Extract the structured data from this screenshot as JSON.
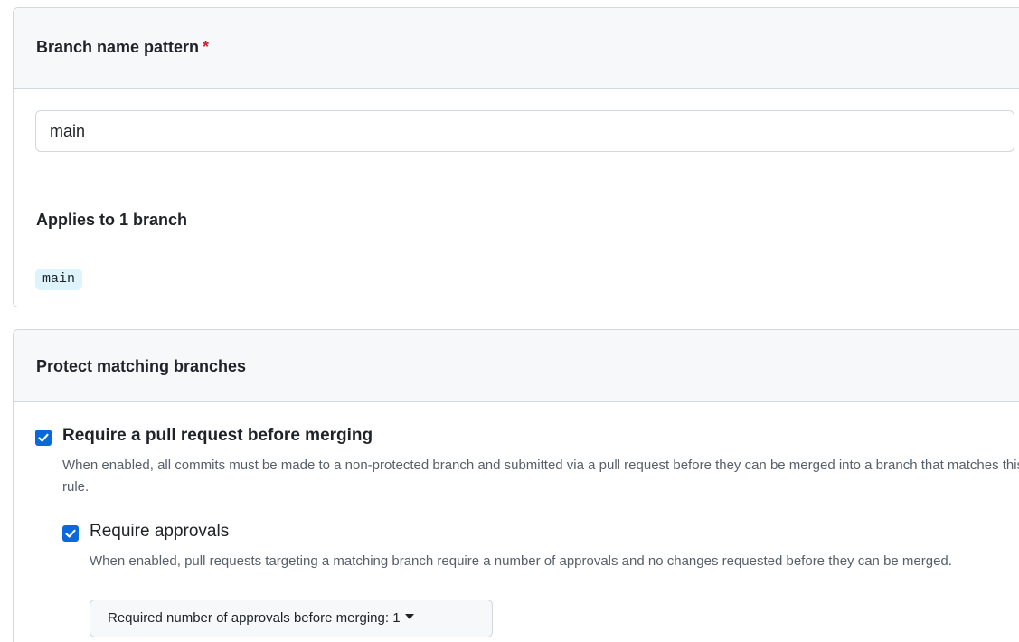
{
  "branch_pattern": {
    "label": "Branch name pattern",
    "required_marker": "*",
    "value": "main"
  },
  "applies": {
    "title": "Applies to 1 branch",
    "branches": [
      "main"
    ]
  },
  "protect": {
    "title": "Protect matching branches",
    "options": [
      {
        "label": "Require a pull request before merging",
        "description": "When enabled, all commits must be made to a non-protected branch and submitted via a pull request before they can be merged into a branch that matches this rule.",
        "checked": true
      },
      {
        "label": "Require approvals",
        "description": "When enabled, pull requests targeting a matching branch require a number of approvals and no changes requested before they can be merged.",
        "checked": true
      }
    ],
    "approvals_select": {
      "label": "Required number of approvals before merging:",
      "value": "1"
    }
  },
  "colors": {
    "accent": "#0969da",
    "required": "#cf222e",
    "branch_chip_bg": "#ddf4ff"
  },
  "icons": {
    "checkbox": "checkmark-icon",
    "dropdown": "caret-down-icon"
  }
}
